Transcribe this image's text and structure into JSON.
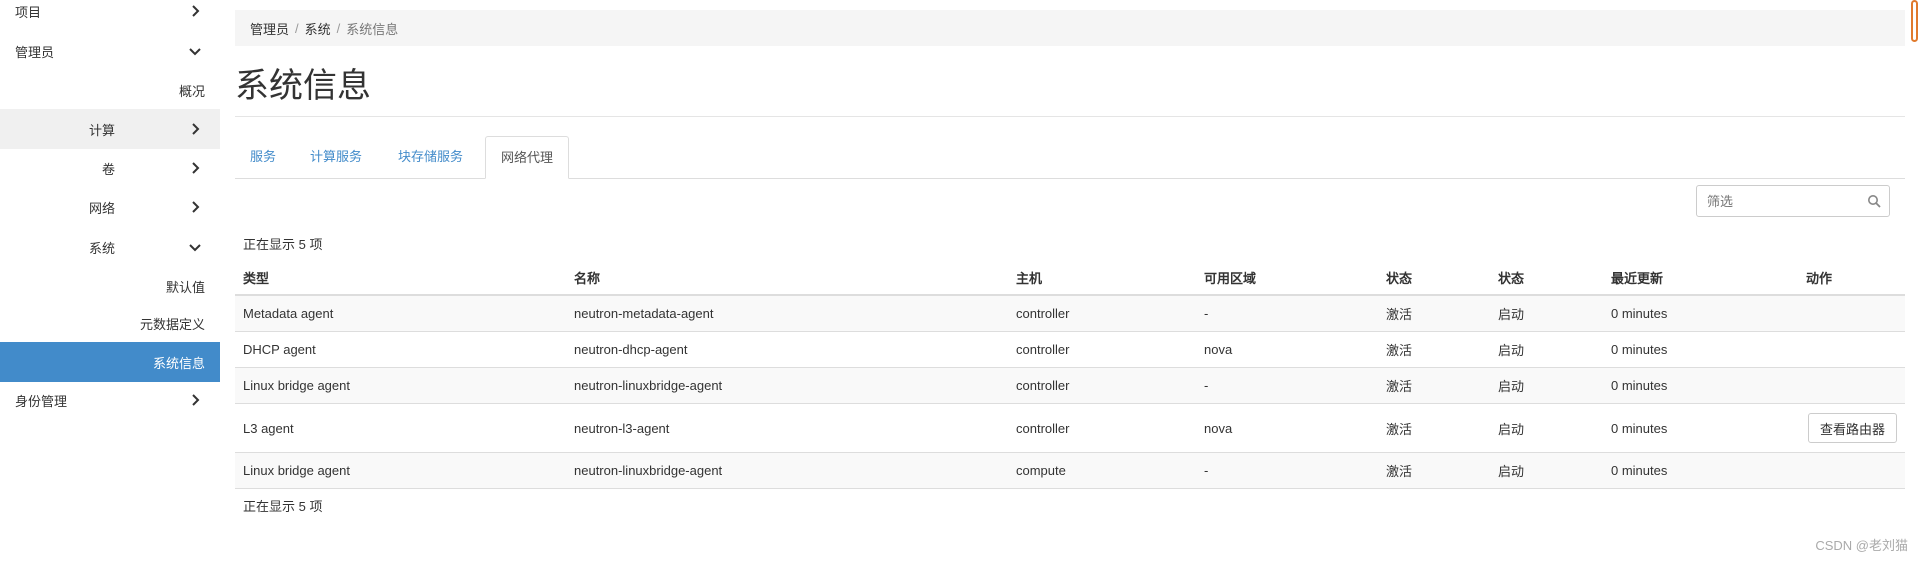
{
  "sidebar": {
    "items": [
      {
        "label": "项目",
        "chevron": "right"
      },
      {
        "label": "管理员",
        "chevron": "down"
      },
      {
        "label": "概况",
        "chevron": ""
      },
      {
        "label": "计算",
        "chevron": "right"
      },
      {
        "label": "卷",
        "chevron": "right"
      },
      {
        "label": "网络",
        "chevron": "right"
      },
      {
        "label": "系统",
        "chevron": "down"
      },
      {
        "label": "默认值",
        "chevron": ""
      },
      {
        "label": "元数据定义",
        "chevron": ""
      },
      {
        "label": "系统信息",
        "chevron": ""
      },
      {
        "label": "身份管理",
        "chevron": "right"
      }
    ]
  },
  "breadcrumb": [
    "管理员",
    "系统",
    "系统信息"
  ],
  "page_title": "系统信息",
  "tabs": [
    "服务",
    "计算服务",
    "块存储服务",
    "网络代理"
  ],
  "active_tab": "网络代理",
  "filter": {
    "placeholder": "筛选",
    "icon": "search-icon"
  },
  "count_text": "正在显示 5 项",
  "table": {
    "headers": [
      "类型",
      "名称",
      "主机",
      "可用区域",
      "状态",
      "状态",
      "最近更新",
      "动作"
    ],
    "rows": [
      [
        "Metadata agent",
        "neutron-metadata-agent",
        "controller",
        "-",
        "激活",
        "启动",
        "0 minutes",
        ""
      ],
      [
        "DHCP agent",
        "neutron-dhcp-agent",
        "controller",
        "nova",
        "激活",
        "启动",
        "0 minutes",
        ""
      ],
      [
        "Linux bridge agent",
        "neutron-linuxbridge-agent",
        "controller",
        "-",
        "激活",
        "启动",
        "0 minutes",
        ""
      ],
      [
        "L3 agent",
        "neutron-l3-agent",
        "controller",
        "nova",
        "激活",
        "启动",
        "0 minutes",
        "查看路由器"
      ],
      [
        "Linux bridge agent",
        "neutron-linuxbridge-agent",
        "compute",
        "-",
        "激活",
        "启动",
        "0 minutes",
        ""
      ]
    ]
  },
  "footer": "CSDN @老刘猫",
  "colors": {
    "accent": "#428bca",
    "link": "#428bca",
    "active_bg": "#428bca"
  }
}
